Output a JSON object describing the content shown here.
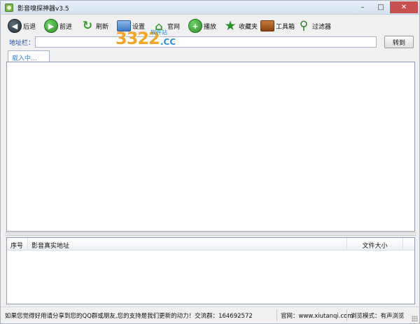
{
  "window": {
    "title": "影音嗅探神器v3.5",
    "controls": [
      "–",
      "□",
      "✕"
    ]
  },
  "toolbar": {
    "back": {
      "label": "后退",
      "icon": "back-arrow-icon"
    },
    "forward": {
      "label": "前进",
      "icon": "forward-arrow-icon"
    },
    "refresh": {
      "label": "刷新",
      "icon": "refresh-icon"
    },
    "settings": {
      "label": "设置",
      "icon": "settings-icon"
    },
    "homepage": {
      "label": "官网",
      "icon": "home-icon"
    },
    "play": {
      "label": "播放",
      "icon": "play-plus-icon"
    },
    "favorites": {
      "label": "收藏夹",
      "icon": "star-icon"
    },
    "toolbox": {
      "label": "工具箱",
      "icon": "toolbox-icon"
    },
    "filter": {
      "label": "过滤器",
      "icon": "magnifier-icon"
    }
  },
  "watermark": {
    "big": "3322",
    "suffix": ".CC",
    "small": "软件站"
  },
  "address": {
    "label": "地址栏：",
    "value": "",
    "go_label": "转到"
  },
  "tabs": [
    {
      "label": "载入中..."
    }
  ],
  "results": {
    "columns": {
      "no": "序号",
      "url": "影音真实地址",
      "size": "文件大小"
    },
    "rows": []
  },
  "status": {
    "message": "如果您觉得好用请分享到您的QQ群或朋友,您的支持是我们更新的动力！交流群：164692572",
    "website": "官网：www.xiutanqi.com",
    "mode": "浏览模式：有声浏览"
  },
  "colors": {
    "accent_green": "#2f8f2a",
    "address_label": "#1f4ea8",
    "tab_text": "#3a7fd0",
    "close_button": "#c75050"
  }
}
